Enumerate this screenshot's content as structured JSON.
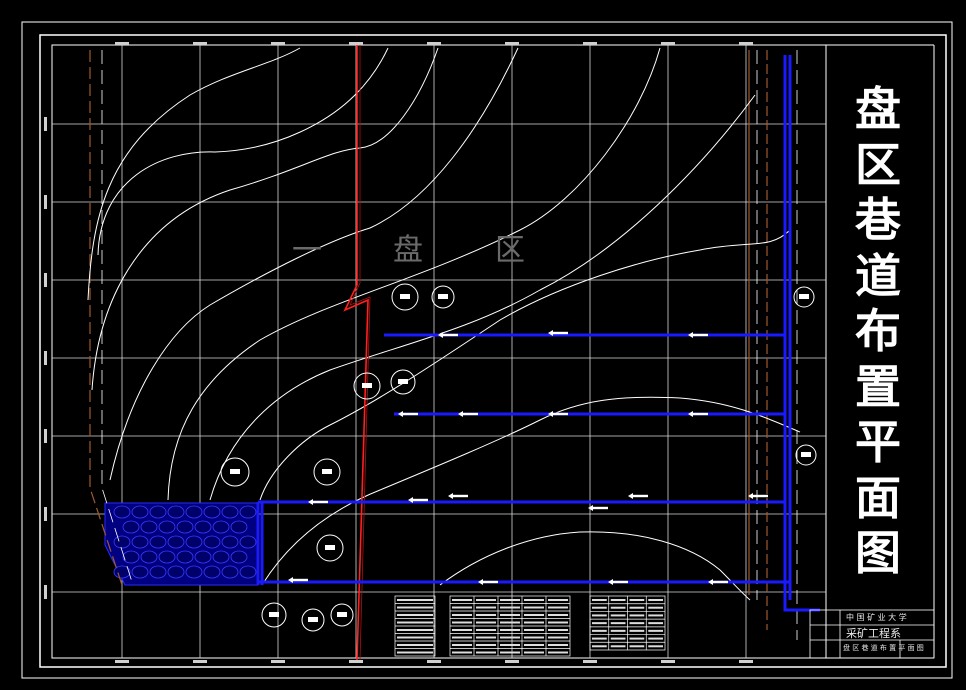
{
  "drawing": {
    "title_chars": [
      "盘",
      "区",
      "巷",
      "道",
      "布",
      "置",
      "平",
      "面",
      "图"
    ],
    "zone_label_chars": [
      "一",
      "盘",
      "区"
    ]
  },
  "title_block": {
    "school": "中 国 矿 业 大 学",
    "department": "采矿工程系",
    "drawing_name": "盘 区 巷 道 布 置 平 面 图"
  },
  "colors": {
    "background": "#000000",
    "contour": "#ffffff",
    "grid": "#ffffff",
    "roadway": "#1a1aff",
    "fault": "#ff2020",
    "boundary": "#a05a2c",
    "gob_fill": "#0000aa"
  }
}
